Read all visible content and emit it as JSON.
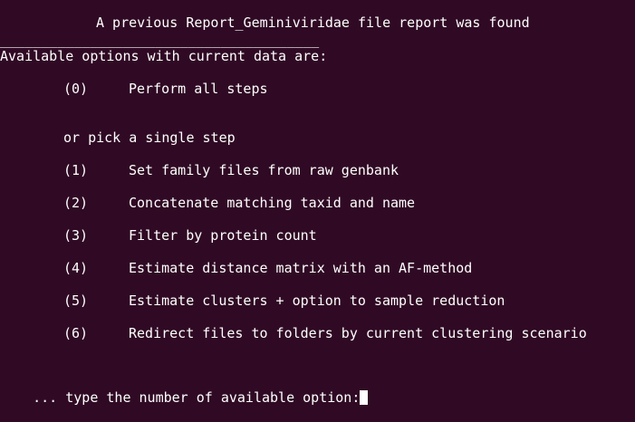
{
  "terminal": {
    "title": "A previous Report_Geminiviridae file report was found",
    "separator": "_______________________________________",
    "header": "Available options with current data are:",
    "all_option": {
      "number": "(0)",
      "label": "Perform all steps"
    },
    "or_pick": "or pick a single step",
    "options": [
      {
        "number": "(1)",
        "label": "Set family files from raw genbank"
      },
      {
        "number": "(2)",
        "label": "Concatenate matching taxid and name"
      },
      {
        "number": "(3)",
        "label": "Filter by protein count"
      },
      {
        "number": "(4)",
        "label": "Estimate distance matrix with an AF-method"
      },
      {
        "number": "(5)",
        "label": "Estimate clusters + option to sample reduction"
      },
      {
        "number": "(6)",
        "label": "Redirect files to folders by current clustering scenario"
      }
    ],
    "prompt": "... type the number of available option:",
    "colors": {
      "background": "#300a24",
      "text": "#ffffff"
    }
  }
}
